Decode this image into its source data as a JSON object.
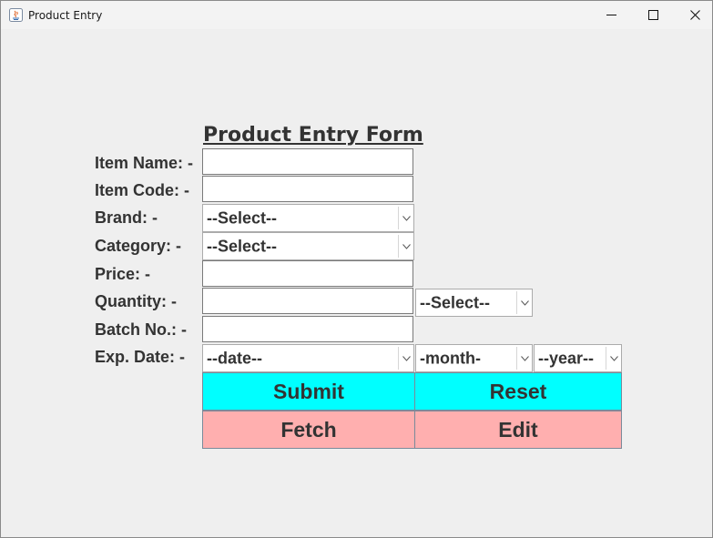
{
  "window": {
    "title": "Product Entry",
    "icons": [
      "java-icon",
      "minimize-icon",
      "maximize-icon",
      "close-icon"
    ]
  },
  "form": {
    "heading": "Product Entry Form",
    "labels": {
      "item_name": "Item Name: -",
      "item_code": "Item Code: -",
      "brand": "Brand: -",
      "category": "Category: -",
      "price": "Price: -",
      "quantity": "Quantity: -",
      "batch_no": "Batch No.: -",
      "exp_date": "Exp. Date: -"
    },
    "fields": {
      "item_name": "",
      "item_code": "",
      "price": "",
      "quantity": "",
      "batch_no": ""
    },
    "selects": {
      "brand": "--Select--",
      "category": "--Select--",
      "quantity_unit": "--Select--",
      "date": "--date--",
      "month": "-month-",
      "year": "--year--"
    },
    "buttons": {
      "submit": "Submit",
      "reset": "Reset",
      "fetch": "Fetch",
      "edit": "Edit"
    }
  },
  "colors": {
    "primary_buttons": "#00ffff",
    "secondary_buttons": "#ffafaf",
    "background": "#efefef"
  }
}
